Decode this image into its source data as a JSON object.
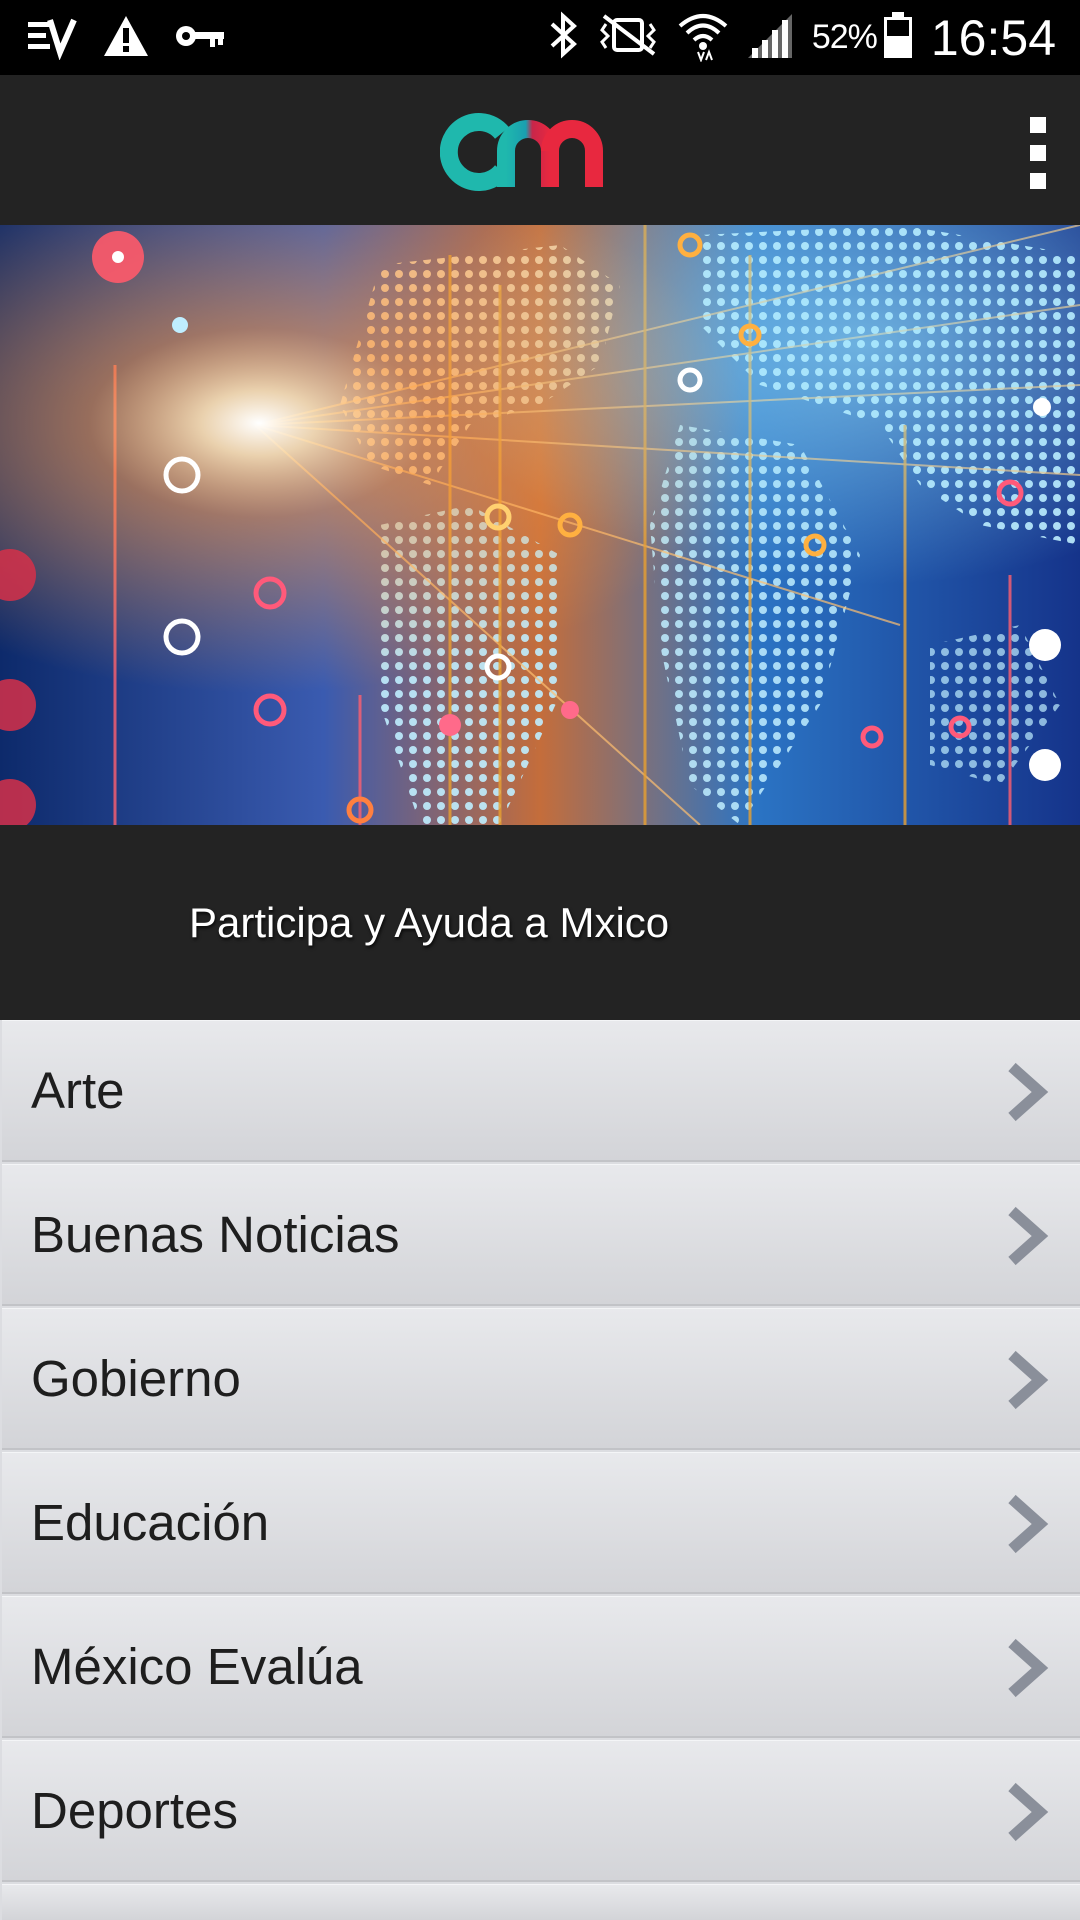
{
  "status_bar": {
    "left_icons": [
      "ev-icon",
      "warning-icon",
      "key-icon"
    ],
    "right_icons": [
      "bluetooth-icon",
      "vibrate-icon",
      "wifi-icon",
      "signal-icon",
      "battery-icon"
    ],
    "battery_percent": "52%",
    "time": "16:54"
  },
  "app_bar": {
    "logo_icon": "cm-logo-icon",
    "menu_icon": "overflow-menu-icon"
  },
  "hero": {
    "image_icon": "world-map-digital-banner"
  },
  "caption": {
    "text": "Participa y Ayuda a Mxico"
  },
  "menu": {
    "items": [
      {
        "label": "Arte"
      },
      {
        "label": "Buenas Noticias"
      },
      {
        "label": "Gobierno"
      },
      {
        "label": "Educación"
      },
      {
        "label": "México Evalúa"
      },
      {
        "label": "Deportes"
      },
      {
        "label": ""
      }
    ],
    "chevron_icon": "chevron-right-icon"
  },
  "colors": {
    "app_bar_bg": "#232323",
    "status_bar_bg": "#000000",
    "logo_teal": "#1fb8ad",
    "logo_red": "#e8283f",
    "row_text": "#1e1e1e",
    "chevron": "#8a8f9a"
  }
}
